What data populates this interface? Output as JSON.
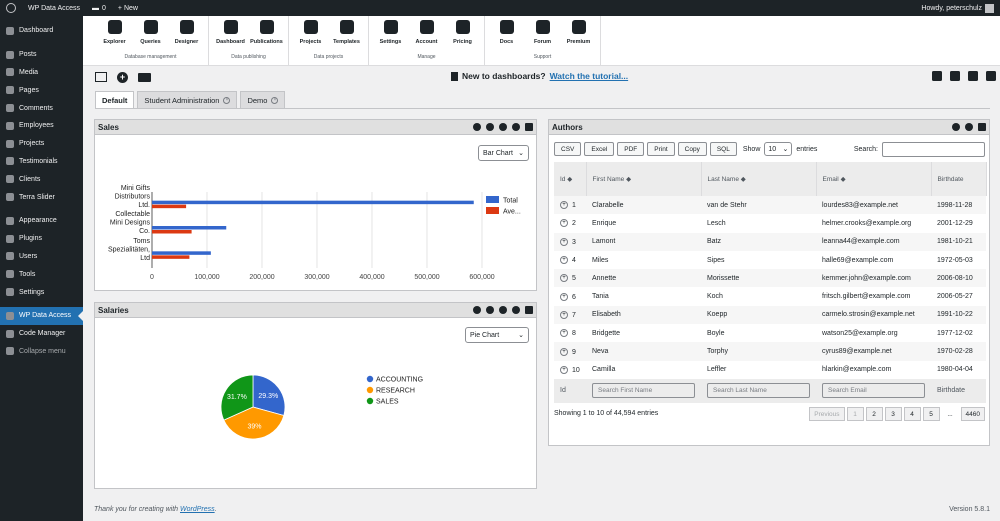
{
  "adminbar": {
    "site": "WP Data Access",
    "comments": "0",
    "new": "+ New",
    "greeting": "Howdy, peterschulz"
  },
  "sidebar": {
    "items": [
      {
        "label": "Dashboard",
        "icon": "dashboard-icon"
      },
      {
        "label": "Posts",
        "icon": "pin-icon"
      },
      {
        "label": "Media",
        "icon": "media-icon"
      },
      {
        "label": "Pages",
        "icon": "page-icon"
      },
      {
        "label": "Comments",
        "icon": "comment-icon"
      },
      {
        "label": "Employees",
        "icon": "employees-icon"
      },
      {
        "label": "Projects",
        "icon": "projects-icon"
      },
      {
        "label": "Testimonials",
        "icon": "testimonials-icon"
      },
      {
        "label": "Clients",
        "icon": "clients-icon"
      },
      {
        "label": "Terra Slider",
        "icon": "slider-icon"
      },
      {
        "label": "Appearance",
        "icon": "brush-icon"
      },
      {
        "label": "Plugins",
        "icon": "plugin-icon"
      },
      {
        "label": "Users",
        "icon": "users-icon"
      },
      {
        "label": "Tools",
        "icon": "tools-icon"
      },
      {
        "label": "Settings",
        "icon": "settings-icon"
      },
      {
        "label": "WP Data Access",
        "icon": "database-icon"
      },
      {
        "label": "Code Manager",
        "icon": "code-icon"
      },
      {
        "label": "Collapse menu",
        "icon": "collapse-icon"
      }
    ]
  },
  "toolbar": {
    "groups": [
      {
        "name": "Database management",
        "buttons": [
          "Explorer",
          "Queries",
          "Designer"
        ]
      },
      {
        "name": "Data publishing",
        "buttons": [
          "Dashboard",
          "Publications"
        ]
      },
      {
        "name": "Data projects",
        "buttons": [
          "Projects",
          "Templates"
        ]
      },
      {
        "name": "Manage",
        "buttons": [
          "Settings",
          "Account",
          "Pricing"
        ]
      },
      {
        "name": "Support",
        "buttons": [
          "Docs",
          "Forum",
          "Premium"
        ]
      }
    ]
  },
  "notice": {
    "text": "New to dashboards?",
    "link": "Watch the tutorial..."
  },
  "tabs": [
    "Default",
    "Student Administration",
    "Demo"
  ],
  "sales": {
    "title": "Sales",
    "select": "Bar Chart"
  },
  "salaries": {
    "title": "Salaries",
    "select": "Pie Chart"
  },
  "authors": {
    "title": "Authors",
    "buttons": [
      "CSV",
      "Excel",
      "PDF",
      "Print",
      "Copy",
      "SQL"
    ],
    "show_label": "Show",
    "entries_value": "10",
    "entries_label": "entries",
    "search_label": "Search:",
    "columns": [
      "Id",
      "First Name",
      "Last Name",
      "Email",
      "Birthdate"
    ],
    "rows": [
      [
        "1",
        "Clarabelle",
        "van de Stehr",
        "lourdes83@example.net",
        "1998-11-28"
      ],
      [
        "2",
        "Enrique",
        "Lesch",
        "helmer.crooks@example.org",
        "2001-12-29"
      ],
      [
        "3",
        "Lamont",
        "Batz",
        "leanna44@example.com",
        "1981-10-21"
      ],
      [
        "4",
        "Miles",
        "Sipes",
        "halle69@example.com",
        "1972-05-03"
      ],
      [
        "5",
        "Annette",
        "Morissette",
        "kemmer.john@example.com",
        "2006-08-10"
      ],
      [
        "6",
        "Tania",
        "Koch",
        "fritsch.gilbert@example.com",
        "2006-05-27"
      ],
      [
        "7",
        "Elisabeth",
        "Koepp",
        "carmelo.strosin@example.net",
        "1991-10-22"
      ],
      [
        "8",
        "Bridgette",
        "Boyle",
        "watson25@example.org",
        "1977-12-02"
      ],
      [
        "9",
        "Neva",
        "Torphy",
        "cyrus89@example.net",
        "1970-02-28"
      ],
      [
        "10",
        "Camilla",
        "Leffler",
        "hlarkin@example.com",
        "1980-04-04"
      ]
    ],
    "footer": {
      "id": "Id",
      "first": "Search First Name",
      "last": "Search Last Name",
      "email": "Search Email",
      "birth": "Birthdate"
    },
    "info": "Showing 1 to 10 of 44,594 entries",
    "pager": [
      "Previous",
      "1",
      "2",
      "3",
      "4",
      "5",
      "...",
      "4460"
    ]
  },
  "footer": {
    "text": "Thank you for creating with",
    "link": "WordPress",
    "version": "Version 5.8.1"
  },
  "colors": {
    "total": "#3366cc",
    "average": "#dc3912",
    "accounting": "#3366cc",
    "research": "#ff9900",
    "sales": "#109618",
    "accent": "#2271b1"
  },
  "chart_data": [
    {
      "type": "bar",
      "orientation": "horizontal",
      "categories": [
        "Mini Gifts Distributors Ltd.",
        "Collectable Mini Designs Co.",
        "Toms Spezialitäten, Ltd"
      ],
      "series": [
        {
          "name": "Total",
          "values": [
            585000,
            135000,
            107000
          ]
        },
        {
          "name": "Ave...",
          "values": [
            62000,
            72000,
            68000
          ]
        }
      ],
      "xticks": [
        "0",
        "100,000",
        "200,000",
        "300,000",
        "400,000",
        "500,000",
        "600,000"
      ],
      "xlim": [
        0,
        600000
      ],
      "legend": "right",
      "grid": true
    },
    {
      "type": "pie",
      "categories": [
        "ACCOUNTING",
        "RESEARCH",
        "SALES"
      ],
      "values": [
        29.3,
        39,
        31.7
      ],
      "labels": [
        "29.3%",
        "39%",
        "31.7%"
      ],
      "legend": "right"
    }
  ]
}
